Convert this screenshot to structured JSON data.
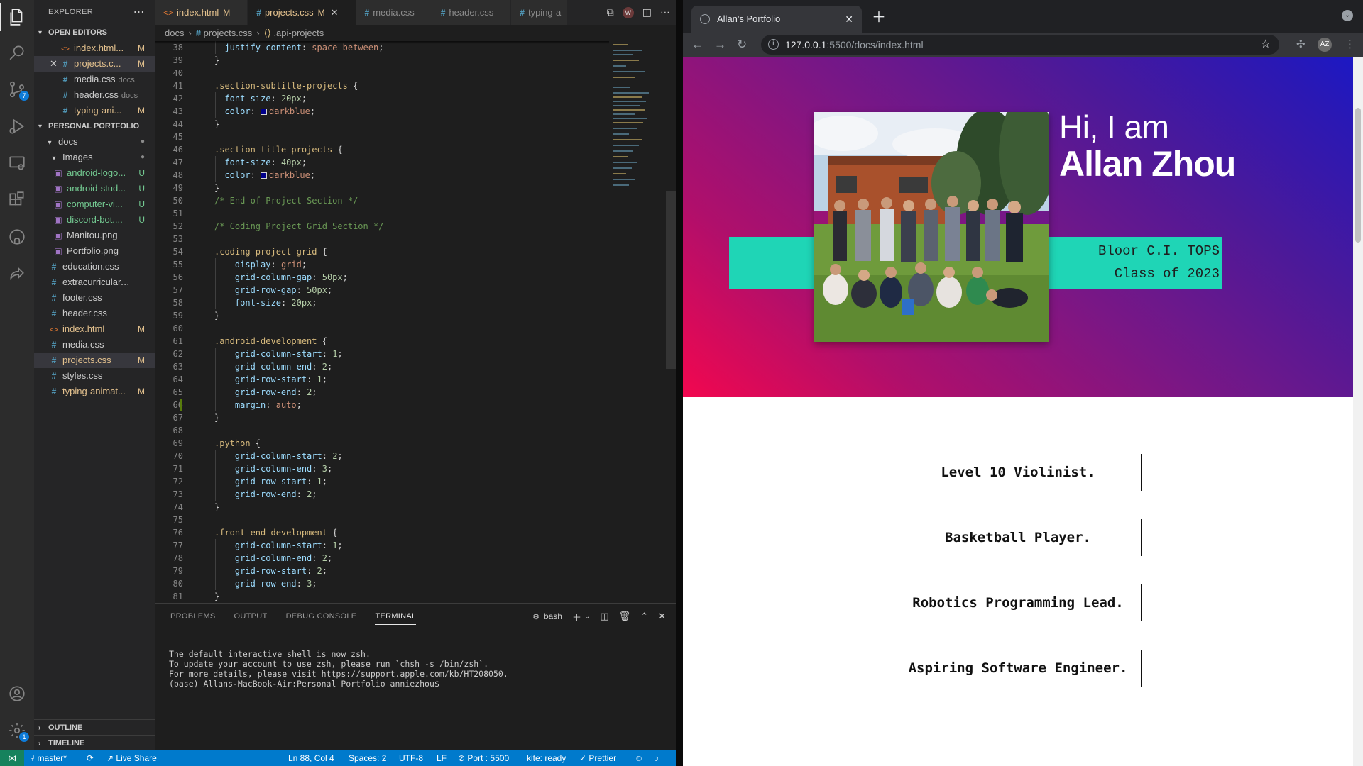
{
  "vscode": {
    "explorer_title": "EXPLORER",
    "open_editors_title": "OPEN EDITORS",
    "open_editors": [
      {
        "name": "index.html...",
        "flag": "M",
        "type": "html"
      },
      {
        "name": "projects.c...",
        "flag": "M",
        "type": "css"
      },
      {
        "name": "media.css",
        "dir": "docs",
        "flag": "",
        "type": "css"
      },
      {
        "name": "header.css",
        "dir": "docs",
        "flag": "",
        "type": "css"
      },
      {
        "name": "typing-ani...",
        "flag": "M",
        "type": "css"
      }
    ],
    "project_title": "PERSONAL PORTFOLIO",
    "tree": [
      {
        "name": "docs",
        "type": "folder"
      },
      {
        "name": "Images",
        "type": "folder"
      },
      {
        "name": "android-logo...",
        "flag": "U",
        "type": "img"
      },
      {
        "name": "android-stud...",
        "flag": "U",
        "type": "img"
      },
      {
        "name": "computer-vi...",
        "flag": "U",
        "type": "img"
      },
      {
        "name": "discord-bot....",
        "flag": "U",
        "type": "img"
      },
      {
        "name": "Manitou.png",
        "flag": "",
        "type": "img"
      },
      {
        "name": "Portfolio.png",
        "flag": "",
        "type": "img"
      },
      {
        "name": "education.css",
        "flag": "",
        "type": "css"
      },
      {
        "name": "extracurricular.css",
        "flag": "",
        "type": "css"
      },
      {
        "name": "footer.css",
        "flag": "",
        "type": "css"
      },
      {
        "name": "header.css",
        "flag": "",
        "type": "css"
      },
      {
        "name": "index.html",
        "flag": "M",
        "type": "html"
      },
      {
        "name": "media.css",
        "flag": "",
        "type": "css"
      },
      {
        "name": "projects.css",
        "flag": "M",
        "type": "css"
      },
      {
        "name": "styles.css",
        "flag": "",
        "type": "css"
      },
      {
        "name": "typing-animat...",
        "flag": "M",
        "type": "css"
      }
    ],
    "outline_label": "OUTLINE",
    "timeline_label": "TIMELINE",
    "tabs": [
      {
        "name": "index.html",
        "flag": "M",
        "type": "html"
      },
      {
        "name": "projects.css",
        "flag": "M",
        "type": "css",
        "active": true
      },
      {
        "name": "media.css",
        "flag": "",
        "type": "css"
      },
      {
        "name": "header.css",
        "flag": "",
        "type": "css"
      },
      {
        "name": "typing-a",
        "flag": "",
        "type": "css"
      }
    ],
    "breadcrumb": {
      "folder": "docs",
      "file": "projects.css",
      "symbol": ".api-projects"
    },
    "code_lines": [
      {
        "n": 38,
        "t": "  justify-content: space-between;"
      },
      {
        "n": 39,
        "t": "}"
      },
      {
        "n": 40,
        "t": ""
      },
      {
        "n": 41,
        "t": ".section-subtitle-projects {"
      },
      {
        "n": 42,
        "t": "  font-size: 20px;"
      },
      {
        "n": 43,
        "t": "  color: darkblue;"
      },
      {
        "n": 44,
        "t": "}"
      },
      {
        "n": 45,
        "t": ""
      },
      {
        "n": 46,
        "t": ".section-title-projects {"
      },
      {
        "n": 47,
        "t": "  font-size: 40px;"
      },
      {
        "n": 48,
        "t": "  color: darkblue;"
      },
      {
        "n": 49,
        "t": "}"
      },
      {
        "n": 50,
        "t": "/* End of Project Section */"
      },
      {
        "n": 51,
        "t": ""
      },
      {
        "n": 52,
        "t": "/* Coding Project Grid Section */"
      },
      {
        "n": 53,
        "t": ""
      },
      {
        "n": 54,
        "t": ".coding-project-grid {"
      },
      {
        "n": 55,
        "t": "    display: grid;"
      },
      {
        "n": 56,
        "t": "    grid-column-gap: 50px;"
      },
      {
        "n": 57,
        "t": "    grid-row-gap: 50px;"
      },
      {
        "n": 58,
        "t": "    font-size: 20px;"
      },
      {
        "n": 59,
        "t": "}"
      },
      {
        "n": 60,
        "t": ""
      },
      {
        "n": 61,
        "t": ".android-development {"
      },
      {
        "n": 62,
        "t": "    grid-column-start: 1;"
      },
      {
        "n": 63,
        "t": "    grid-column-end: 2;"
      },
      {
        "n": 64,
        "t": "    grid-row-start: 1;"
      },
      {
        "n": 65,
        "t": "    grid-row-end: 2;"
      },
      {
        "n": 66,
        "t": "    margin: auto;"
      },
      {
        "n": 67,
        "t": "}"
      },
      {
        "n": 68,
        "t": ""
      },
      {
        "n": 69,
        "t": ".python {"
      },
      {
        "n": 70,
        "t": "    grid-column-start: 2;"
      },
      {
        "n": 71,
        "t": "    grid-column-end: 3;"
      },
      {
        "n": 72,
        "t": "    grid-row-start: 1;"
      },
      {
        "n": 73,
        "t": "    grid-row-end: 2;"
      },
      {
        "n": 74,
        "t": "}"
      },
      {
        "n": 75,
        "t": ""
      },
      {
        "n": 76,
        "t": ".front-end-development {"
      },
      {
        "n": 77,
        "t": "    grid-column-start: 1;"
      },
      {
        "n": 78,
        "t": "    grid-column-end: 2;"
      },
      {
        "n": 79,
        "t": "    grid-row-start: 2;"
      },
      {
        "n": 80,
        "t": "    grid-row-end: 3;"
      },
      {
        "n": 81,
        "t": "}"
      }
    ],
    "panel_tabs": [
      "PROBLEMS",
      "OUTPUT",
      "DEBUG CONSOLE",
      "TERMINAL"
    ],
    "panel_active": "TERMINAL",
    "terminal_shell": "bash",
    "terminal_lines": [
      "The default interactive shell is now zsh.",
      "To update your account to use zsh, please run `chsh -s /bin/zsh`.",
      "For more details, please visit https://support.apple.com/kb/HT208050.",
      "(base) Allans-MacBook-Air:Personal Portfolio anniezhou$ "
    ],
    "status": {
      "branch": "master*",
      "live_share": "Live Share",
      "cursor": "Ln 88, Col 4",
      "spaces": "Spaces: 2",
      "encoding": "UTF-8",
      "eol": "LF",
      "port": "Port : 5500",
      "kite": "kite: ready",
      "prettier": "Prettier"
    },
    "badges": {
      "source_control": "7",
      "settings": "1"
    }
  },
  "browser": {
    "tab_title": "Allan's Portfolio",
    "url_host": "127.0.0.1",
    "url_rest": ":5500/docs/index.html",
    "page": {
      "greeting": "Hi, I am",
      "name": "Allan Zhou",
      "school_line1": "Bloor C.I. TOPS",
      "school_line2": "Class of 2023",
      "roles": [
        "Level 10 Violinist.",
        "Basketball Player.",
        "Robotics Programming Lead.",
        "Aspiring Software Engineer."
      ]
    },
    "colors": {
      "hero_gradient_start": "#f2074f",
      "hero_gradient_end": "#1c18c4",
      "band": "#1fd5b6"
    }
  }
}
